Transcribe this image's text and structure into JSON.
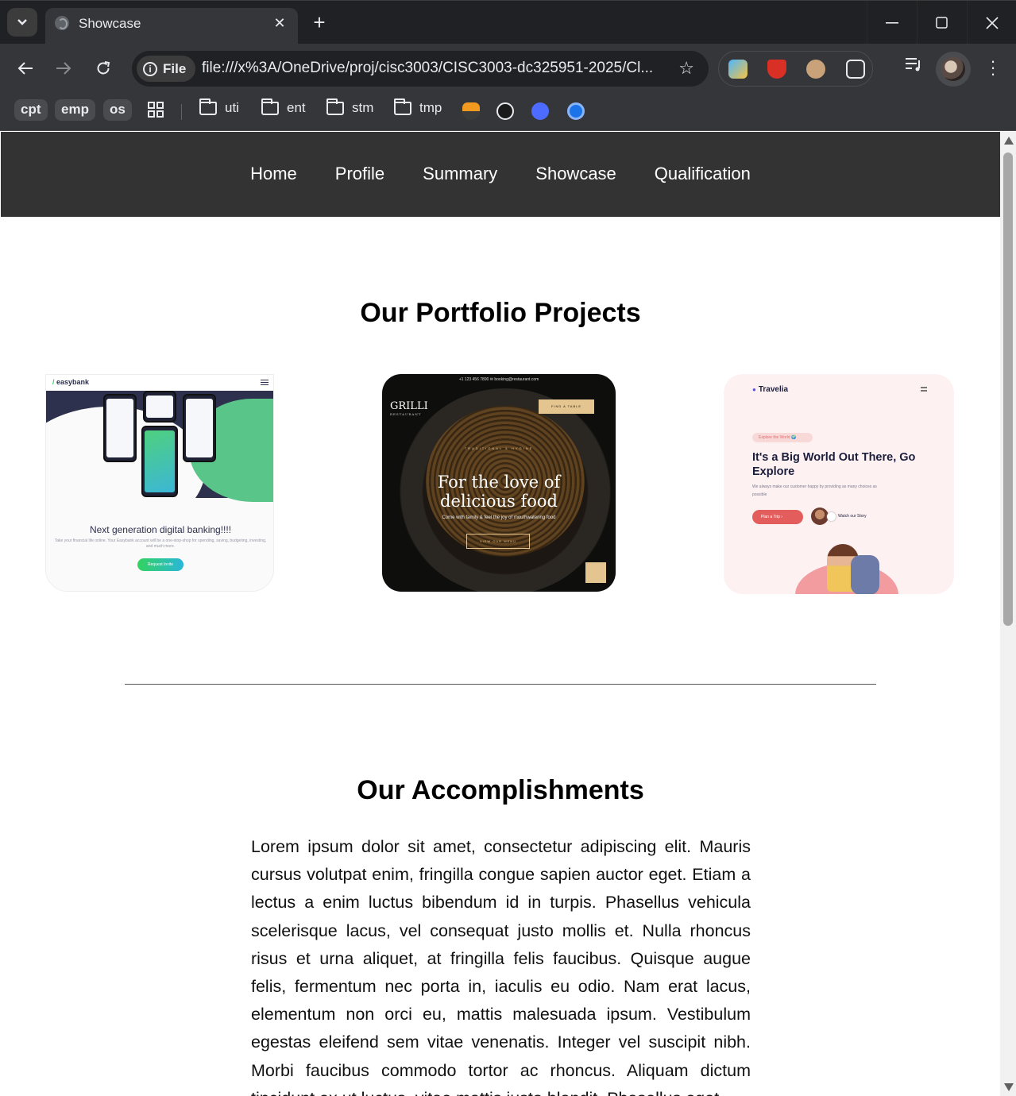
{
  "browser": {
    "tab": {
      "title": "Showcase",
      "close": "✕"
    },
    "new_tab": "+",
    "window_controls": {
      "minimize": "—",
      "maximize": "☐",
      "close": "✕"
    },
    "omnibox": {
      "chip_label": "File",
      "url": "file:///x%3A/OneDrive/proj/cisc3003/CISC3003-dc325951-2025/Cl..."
    },
    "bookmarks": {
      "pills": [
        "cpt",
        "emp",
        "os"
      ],
      "folders": [
        "uti",
        "ent",
        "stm",
        "tmp"
      ]
    }
  },
  "site": {
    "nav": [
      "Home",
      "Profile",
      "Summary",
      "Showcase",
      "Qualification"
    ],
    "portfolio_title": "Our Portfolio Projects",
    "projects": {
      "easybank": {
        "logo": "easybank",
        "tagline": "Next generation digital banking!!!!",
        "sub": "Take your financial life online. Your Easybank account will be a one-stop-shop for spending, saving, budgeting, investing, and much more.",
        "button": "Request Invite"
      },
      "grilli": {
        "topbar": "+1 123 456 7890   ✉ booking@restaurant.com",
        "logo": "GRILLI",
        "logo_sub": "RESTAURANT",
        "find_table": "FIND A TABLE",
        "kicker": "TRADITIONAL & HYGINE",
        "title_line1": "For the love of",
        "title_line2": "delicious food",
        "desc": "Come with family & feel the joy of mouthwatering food",
        "menu_button": "VIEW OUR MENU"
      },
      "travelia": {
        "logo": "Travelia",
        "pill": "Explore the World 🌍",
        "title": "It's a Big World Out There, Go Explore",
        "desc": "We always make our customer happy by providing as many choices as possible",
        "button": "Plan a Trip  ›",
        "story": "Watch our Story"
      }
    },
    "accomplishments_title": "Our Accomplishments",
    "accomplishments_text": "Lorem ipsum dolor sit amet, consectetur adipiscing elit. Mauris cursus volutpat enim, fringilla congue sapien auctor eget. Etiam a lectus a enim luctus bibendum id in turpis. Phasellus vehicula scelerisque lacus, vel consequat justo mollis et. Nulla rhoncus risus et urna aliquet, at fringilla felis faucibus. Quisque augue felis, fermentum nec porta in, iaculis eu odio. Nam erat lacus, elementum non orci eu, mattis malesuada ipsum. Vestibulum egestas eleifend sem vitae venenatis. Integer vel suscipit nibh. Morbi faucibus commodo tortor ac rhoncus. Aliquam dictum tincidunt ex ut luctus, vitae mattis justo blandit. Phasellus eget"
  }
}
